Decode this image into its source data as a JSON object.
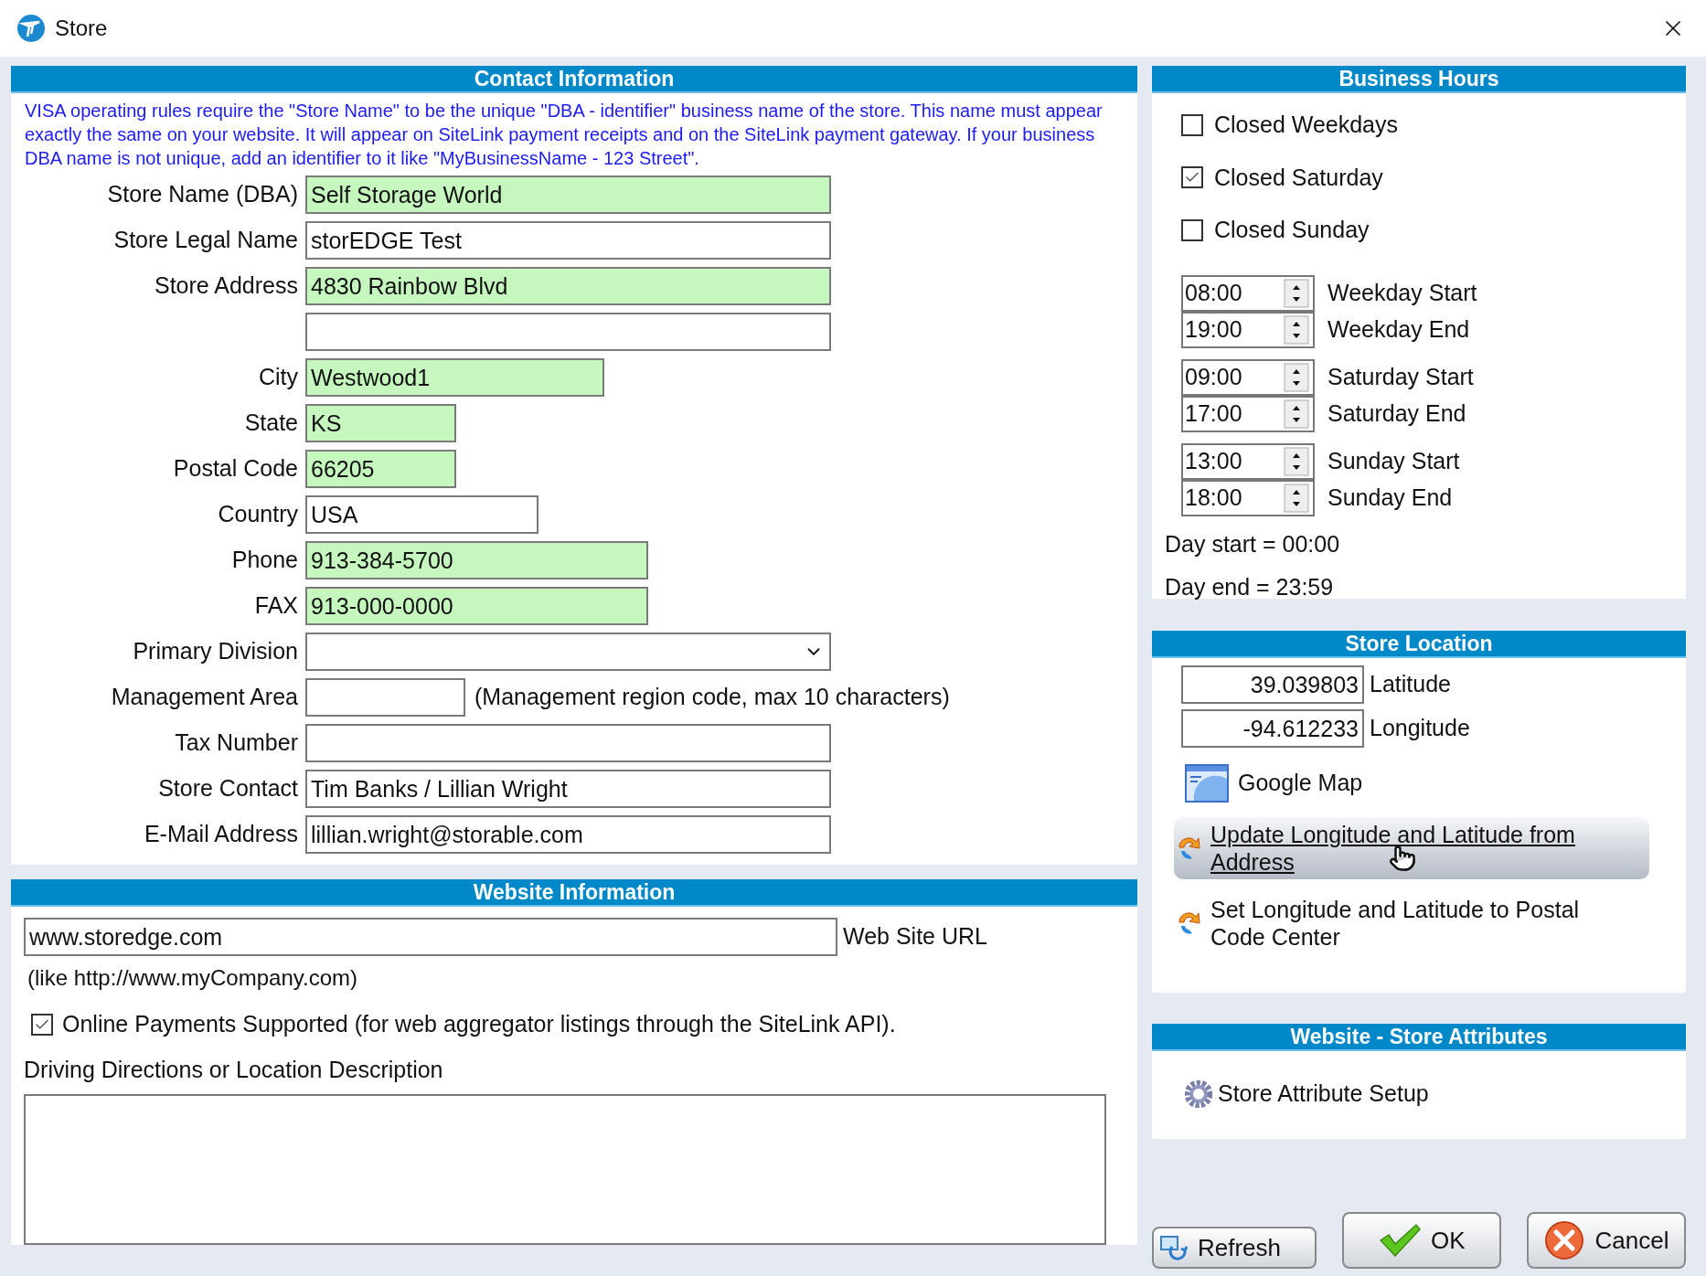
{
  "window": {
    "title": "Store"
  },
  "contact": {
    "title": "Contact Information",
    "notice": "VISA operating rules require the \"Store Name\" to be the unique \"DBA - identifier\" business name of the store. This name must appear exactly the same on your website. It will appear on SiteLink payment receipts and on the SiteLink payment gateway. If your business DBA name is not unique, add an identifier to it like \"MyBusinessName - 123 Street\".",
    "fields": [
      {
        "label": "Store Name (DBA)",
        "value": "Self Storage World",
        "kind": "text",
        "highlighted": true
      },
      {
        "label": "Store Legal Name",
        "value": "storEDGE Test",
        "kind": "text",
        "highlighted": false
      },
      {
        "label": "Store Address",
        "value": "4830 Rainbow Blvd",
        "kind": "text",
        "highlighted": true
      },
      {
        "kind": "text",
        "highlighted": false
      },
      {
        "label": "City",
        "value": "Westwood1",
        "kind": "text",
        "highlighted": true
      },
      {
        "label": "State",
        "value": "KS",
        "kind": "text",
        "highlighted": true
      },
      {
        "label": "Postal Code",
        "value": "66205",
        "kind": "text",
        "highlighted": true
      },
      {
        "label": "Country",
        "value": "USA",
        "kind": "text",
        "highlighted": false
      },
      {
        "label": "Phone",
        "value": "913-384-5700",
        "kind": "text",
        "highlighted": true
      },
      {
        "label": "FAX",
        "value": "913-000-0000",
        "kind": "text",
        "highlighted": true
      },
      {
        "label": "Primary Division",
        "kind": "select",
        "highlighted": false
      },
      {
        "label": "Management Area",
        "kind": "text",
        "highlighted": false,
        "note": "(Management region code,  max 10  characters)"
      },
      {
        "label": "Tax Number",
        "kind": "text",
        "highlighted": false
      },
      {
        "label": "Store Contact",
        "value": "Tim Banks / Lillian Wright",
        "kind": "text",
        "highlighted": false
      },
      {
        "label": "E-Mail Address",
        "value": "lillian.wright@storable.com",
        "kind": "text",
        "highlighted": false
      }
    ]
  },
  "website": {
    "title": "Website Information",
    "url": "www.storedge.com",
    "url_label": "Web Site URL",
    "url_hint": "(like  http://www.myCompany.com)",
    "online_payments": {
      "label": "Online Payments Supported  (for web aggregator listings through the SiteLink API).",
      "checked": true
    },
    "directions_label": "Driving Directions or Location Description"
  },
  "business_hours": {
    "title": "Business Hours",
    "closed": [
      {
        "label": "Closed Weekdays",
        "checked": false
      },
      {
        "label": "Closed Saturday",
        "checked": true
      },
      {
        "label": "Closed Sunday",
        "checked": false
      }
    ],
    "groups": [
      [
        {
          "value": "08:00",
          "label": "Weekday Start"
        },
        {
          "value": "19:00",
          "label": "Weekday End"
        }
      ],
      [
        {
          "value": "09:00",
          "label": "Saturday Start"
        },
        {
          "value": "17:00",
          "label": "Saturday End"
        }
      ],
      [
        {
          "value": "13:00",
          "label": "Sunday Start"
        },
        {
          "value": "18:00",
          "label": "Sunday End"
        }
      ]
    ],
    "notes": [
      "Day start = 00:00",
      "Day end = 23:59"
    ]
  },
  "store_location": {
    "title": "Store Location",
    "coords": [
      {
        "value": "39.039803",
        "label": "Latitude"
      },
      {
        "value": "-94.612233",
        "label": "Longitude"
      }
    ],
    "map_link": "Google Map",
    "actions": [
      {
        "label": "Update Longitude and Latitude from Address",
        "hovered": true
      },
      {
        "label": "Set Longitude and Latitude to Postal Code Center",
        "hovered": false
      }
    ]
  },
  "attributes": {
    "title": "Website - Store Attributes",
    "link": "Store Attribute Setup"
  },
  "buttons": [
    {
      "label": "Refresh",
      "kind": "refresh"
    },
    {
      "label": "OK",
      "kind": "ok"
    },
    {
      "label": "Cancel",
      "kind": "cancel"
    }
  ]
}
